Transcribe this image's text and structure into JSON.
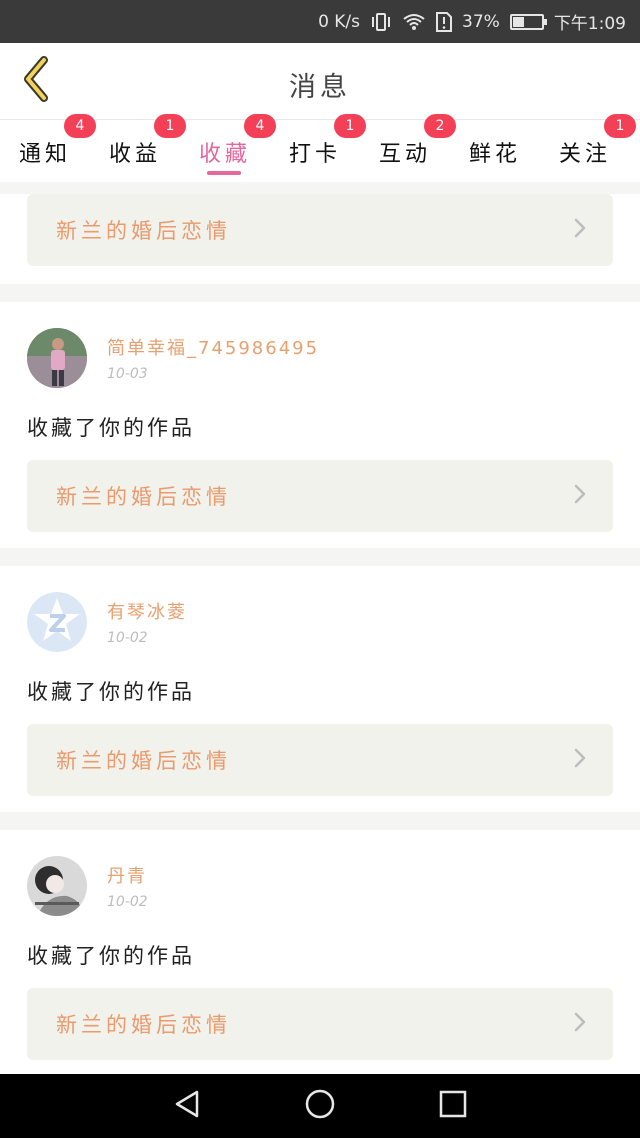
{
  "status": {
    "net": "0 K/s",
    "battery": "37%",
    "time": "下午1:09",
    "battery_level": 0.37
  },
  "header": {
    "title": "消息",
    "back_icon": "chevron-left-icon"
  },
  "tabs": [
    {
      "label": "通知",
      "badge": "4"
    },
    {
      "label": "收益",
      "badge": "1"
    },
    {
      "label": "收藏",
      "badge": "4",
      "active": true
    },
    {
      "label": "打卡",
      "badge": "1"
    },
    {
      "label": "互动",
      "badge": "2"
    },
    {
      "label": "鲜花",
      "badge": ""
    },
    {
      "label": "关注",
      "badge": "1"
    }
  ],
  "first_card": {
    "work_title": "新兰的婚后恋情"
  },
  "items": [
    {
      "username": "简单幸福_745986495",
      "date": "10-03",
      "action": "收藏了你的作品",
      "work_title": "新兰的婚后恋情"
    },
    {
      "username": "有琴冰菱",
      "date": "10-02",
      "action": "收藏了你的作品",
      "work_title": "新兰的婚后恋情"
    },
    {
      "username": "丹青",
      "date": "10-02",
      "action": "收藏了你的作品",
      "work_title": "新兰的婚后恋情"
    }
  ],
  "colors": {
    "accent": "#e5679c",
    "badge": "#f44056",
    "username": "#e8a070",
    "work_title": "#ea9a6c"
  }
}
